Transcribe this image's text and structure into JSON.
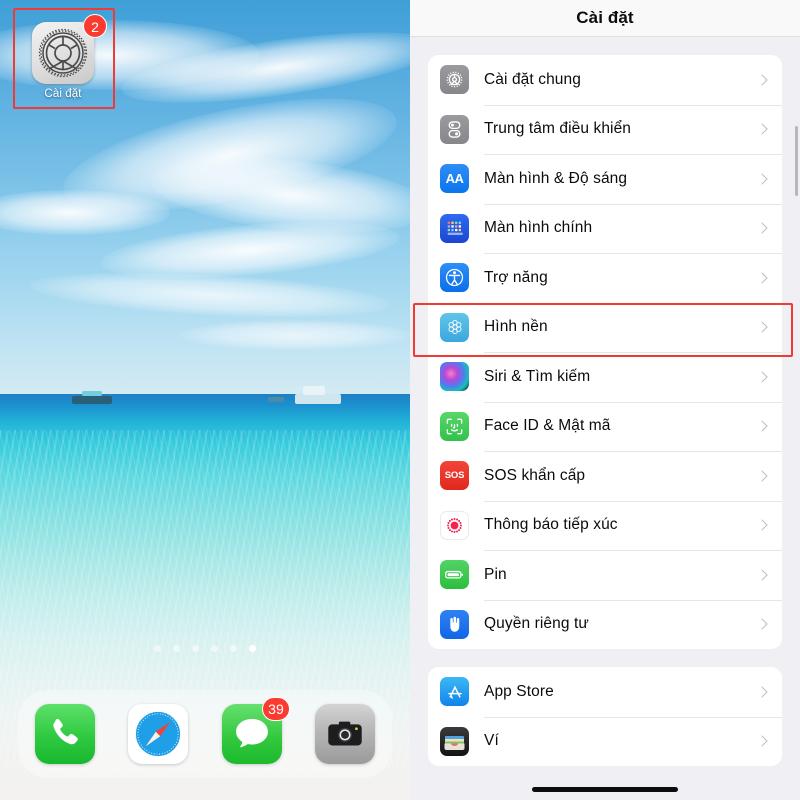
{
  "home_screen": {
    "app": {
      "name": "settings-app-icon",
      "label": "Cài đặt",
      "badge": "2",
      "highlighted": true
    },
    "page_dots": {
      "total": 6,
      "active_index": 5
    },
    "dock": [
      {
        "name": "phone-app-icon",
        "label": "Phone",
        "badge": ""
      },
      {
        "name": "safari-app-icon",
        "label": "Safari",
        "badge": ""
      },
      {
        "name": "messages-app-icon",
        "label": "Messages",
        "badge": "39"
      },
      {
        "name": "camera-app-icon",
        "label": "Camera",
        "badge": ""
      }
    ],
    "wallpaper": "beach-ocean-photo"
  },
  "settings": {
    "title": "Cài đặt",
    "highlight_color": "#ef3b33",
    "groups": [
      {
        "rows": [
          {
            "label": "Cài đặt chung",
            "icon": "gear-icon",
            "icon_class": "i-general"
          },
          {
            "label": "Trung tâm điều khiển",
            "icon": "control-center-icon",
            "icon_class": "i-control"
          },
          {
            "label": "Màn hình & Độ sáng",
            "icon": "display-brightness-icon",
            "icon_class": "i-display",
            "icon_text": "AA"
          },
          {
            "label": "Màn hình chính",
            "icon": "home-screen-icon",
            "icon_class": "i-home"
          },
          {
            "label": "Trợ năng",
            "icon": "accessibility-icon",
            "icon_class": "i-access",
            "highlighted": true
          },
          {
            "label": "Hình nền",
            "icon": "wallpaper-icon",
            "icon_class": "i-wall"
          },
          {
            "label": "Siri & Tìm kiếm",
            "icon": "siri-icon",
            "icon_class": "i-siri"
          },
          {
            "label": "Face ID & Mật mã",
            "icon": "face-id-icon",
            "icon_class": "i-faceid"
          },
          {
            "label": "SOS khẩn cấp",
            "icon": "sos-icon",
            "icon_class": "i-sos",
            "icon_text": "SOS"
          },
          {
            "label": "Thông báo tiếp xúc",
            "icon": "exposure-notification-icon",
            "icon_class": "i-exposure"
          },
          {
            "label": "Pin",
            "icon": "battery-icon",
            "icon_class": "i-battery"
          },
          {
            "label": "Quyền riêng tư",
            "icon": "privacy-hand-icon",
            "icon_class": "i-privacy"
          }
        ]
      },
      {
        "rows": [
          {
            "label": "App Store",
            "icon": "app-store-icon",
            "icon_class": "i-appstore"
          },
          {
            "label": "Ví",
            "icon": "wallet-icon",
            "icon_class": "i-wallet"
          }
        ]
      }
    ]
  }
}
